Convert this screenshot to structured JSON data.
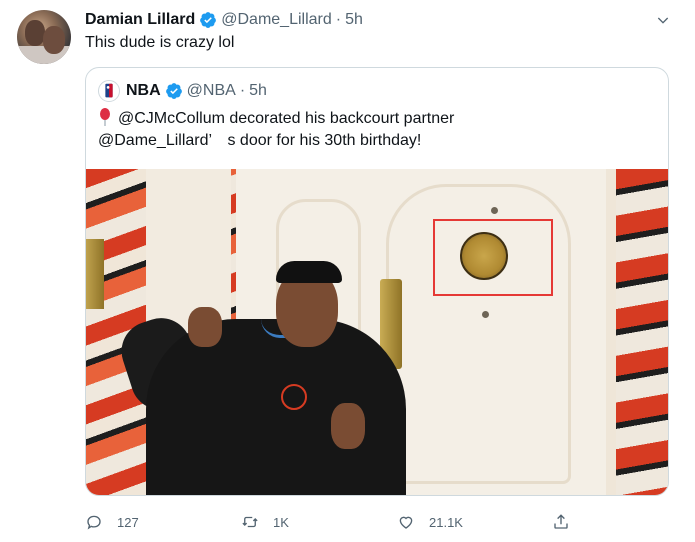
{
  "tweet": {
    "author_name": "Damian Lillard",
    "author_handle": "@Dame_Lillard",
    "separator": "·",
    "time": "5h",
    "text": "This dude is crazy lol"
  },
  "quoted_tweet": {
    "author_name": "NBA",
    "author_handle": "@NBA",
    "separator": "·",
    "time": "5h",
    "text_line1": "@CJMcCollum decorated his backcourt partner",
    "text_line2": "@Dame_Lillard’　s door for his 30th birthday!",
    "emoji": "balloon-icon"
  },
  "actions": {
    "reply_count": "127",
    "retweet_count": "1K",
    "like_count": "21.1K"
  },
  "icons": [
    "verified-badge-icon",
    "chevron-down-icon",
    "balloon-icon",
    "reply-icon",
    "retweet-icon",
    "like-icon",
    "share-icon"
  ],
  "colors": {
    "accent": "#1d9bf0",
    "text": "#0f1419",
    "secondary": "#536471",
    "border": "#cfd9de",
    "highlight_box": "#e53935"
  }
}
